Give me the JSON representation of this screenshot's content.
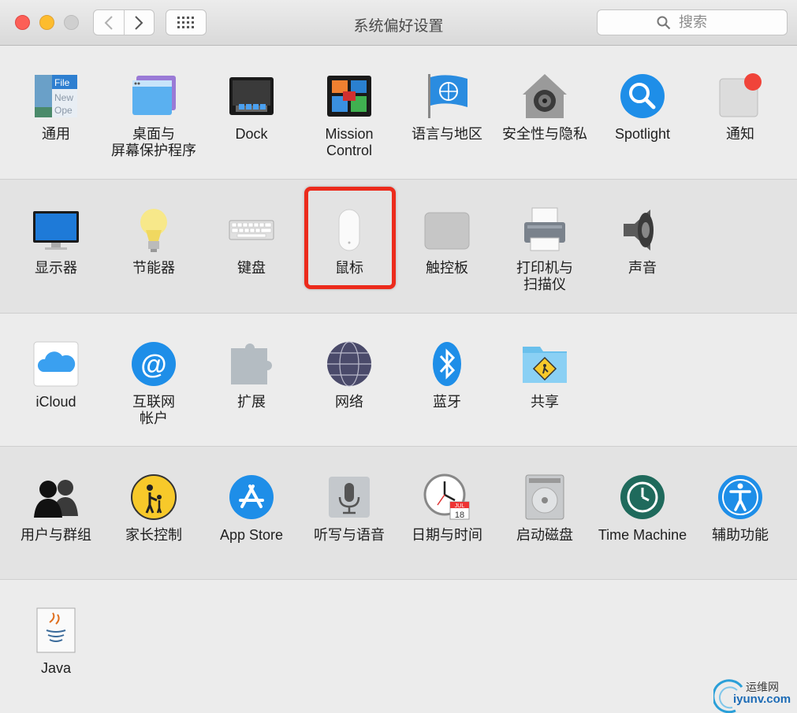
{
  "window": {
    "title": "系统偏好设置",
    "search_placeholder": "搜索"
  },
  "sections": [
    [
      {
        "label": "通用",
        "icon": "general-icon"
      },
      {
        "label": "桌面与\n屏幕保护程序",
        "icon": "desktop-screensaver-icon"
      },
      {
        "label": "Dock",
        "icon": "dock-icon"
      },
      {
        "label": "Mission\nControl",
        "icon": "mission-control-icon"
      },
      {
        "label": "语言与地区",
        "icon": "language-region-icon"
      },
      {
        "label": "安全性与隐私",
        "icon": "security-privacy-icon"
      },
      {
        "label": "Spotlight",
        "icon": "spotlight-icon"
      },
      {
        "label": "通知",
        "icon": "notifications-icon"
      }
    ],
    [
      {
        "label": "显示器",
        "icon": "displays-icon"
      },
      {
        "label": "节能器",
        "icon": "energy-saver-icon"
      },
      {
        "label": "键盘",
        "icon": "keyboard-icon"
      },
      {
        "label": "鼠标",
        "icon": "mouse-icon"
      },
      {
        "label": "触控板",
        "icon": "trackpad-icon"
      },
      {
        "label": "打印机与\n扫描仪",
        "icon": "printers-scanners-icon"
      },
      {
        "label": "声音",
        "icon": "sound-icon"
      }
    ],
    [
      {
        "label": "iCloud",
        "icon": "icloud-icon"
      },
      {
        "label": "互联网\n帐户",
        "icon": "internet-accounts-icon"
      },
      {
        "label": "扩展",
        "icon": "extensions-icon"
      },
      {
        "label": "网络",
        "icon": "network-icon"
      },
      {
        "label": "蓝牙",
        "icon": "bluetooth-icon"
      },
      {
        "label": "共享",
        "icon": "sharing-icon"
      }
    ],
    [
      {
        "label": "用户与群组",
        "icon": "users-groups-icon"
      },
      {
        "label": "家长控制",
        "icon": "parental-controls-icon"
      },
      {
        "label": "App Store",
        "icon": "app-store-icon"
      },
      {
        "label": "听写与语音",
        "icon": "dictation-speech-icon"
      },
      {
        "label": "日期与时间",
        "icon": "date-time-icon"
      },
      {
        "label": "启动磁盘",
        "icon": "startup-disk-icon"
      },
      {
        "label": "Time Machine",
        "icon": "time-machine-icon"
      },
      {
        "label": "辅助功能",
        "icon": "accessibility-icon"
      }
    ],
    [
      {
        "label": "Java",
        "icon": "java-icon"
      }
    ]
  ],
  "icon_text": {
    "general_file": "File",
    "general_new": "New",
    "general_open": "Ope",
    "calendar_month": "JUL",
    "calendar_day": "18"
  },
  "watermark": {
    "line1": "运维网",
    "line2": "iyunv.com"
  },
  "colors": {
    "highlight": "#ec2b1c",
    "close": "#fc5f57",
    "minimize": "#fdbc2e",
    "notification_badge": "#f0443a"
  }
}
